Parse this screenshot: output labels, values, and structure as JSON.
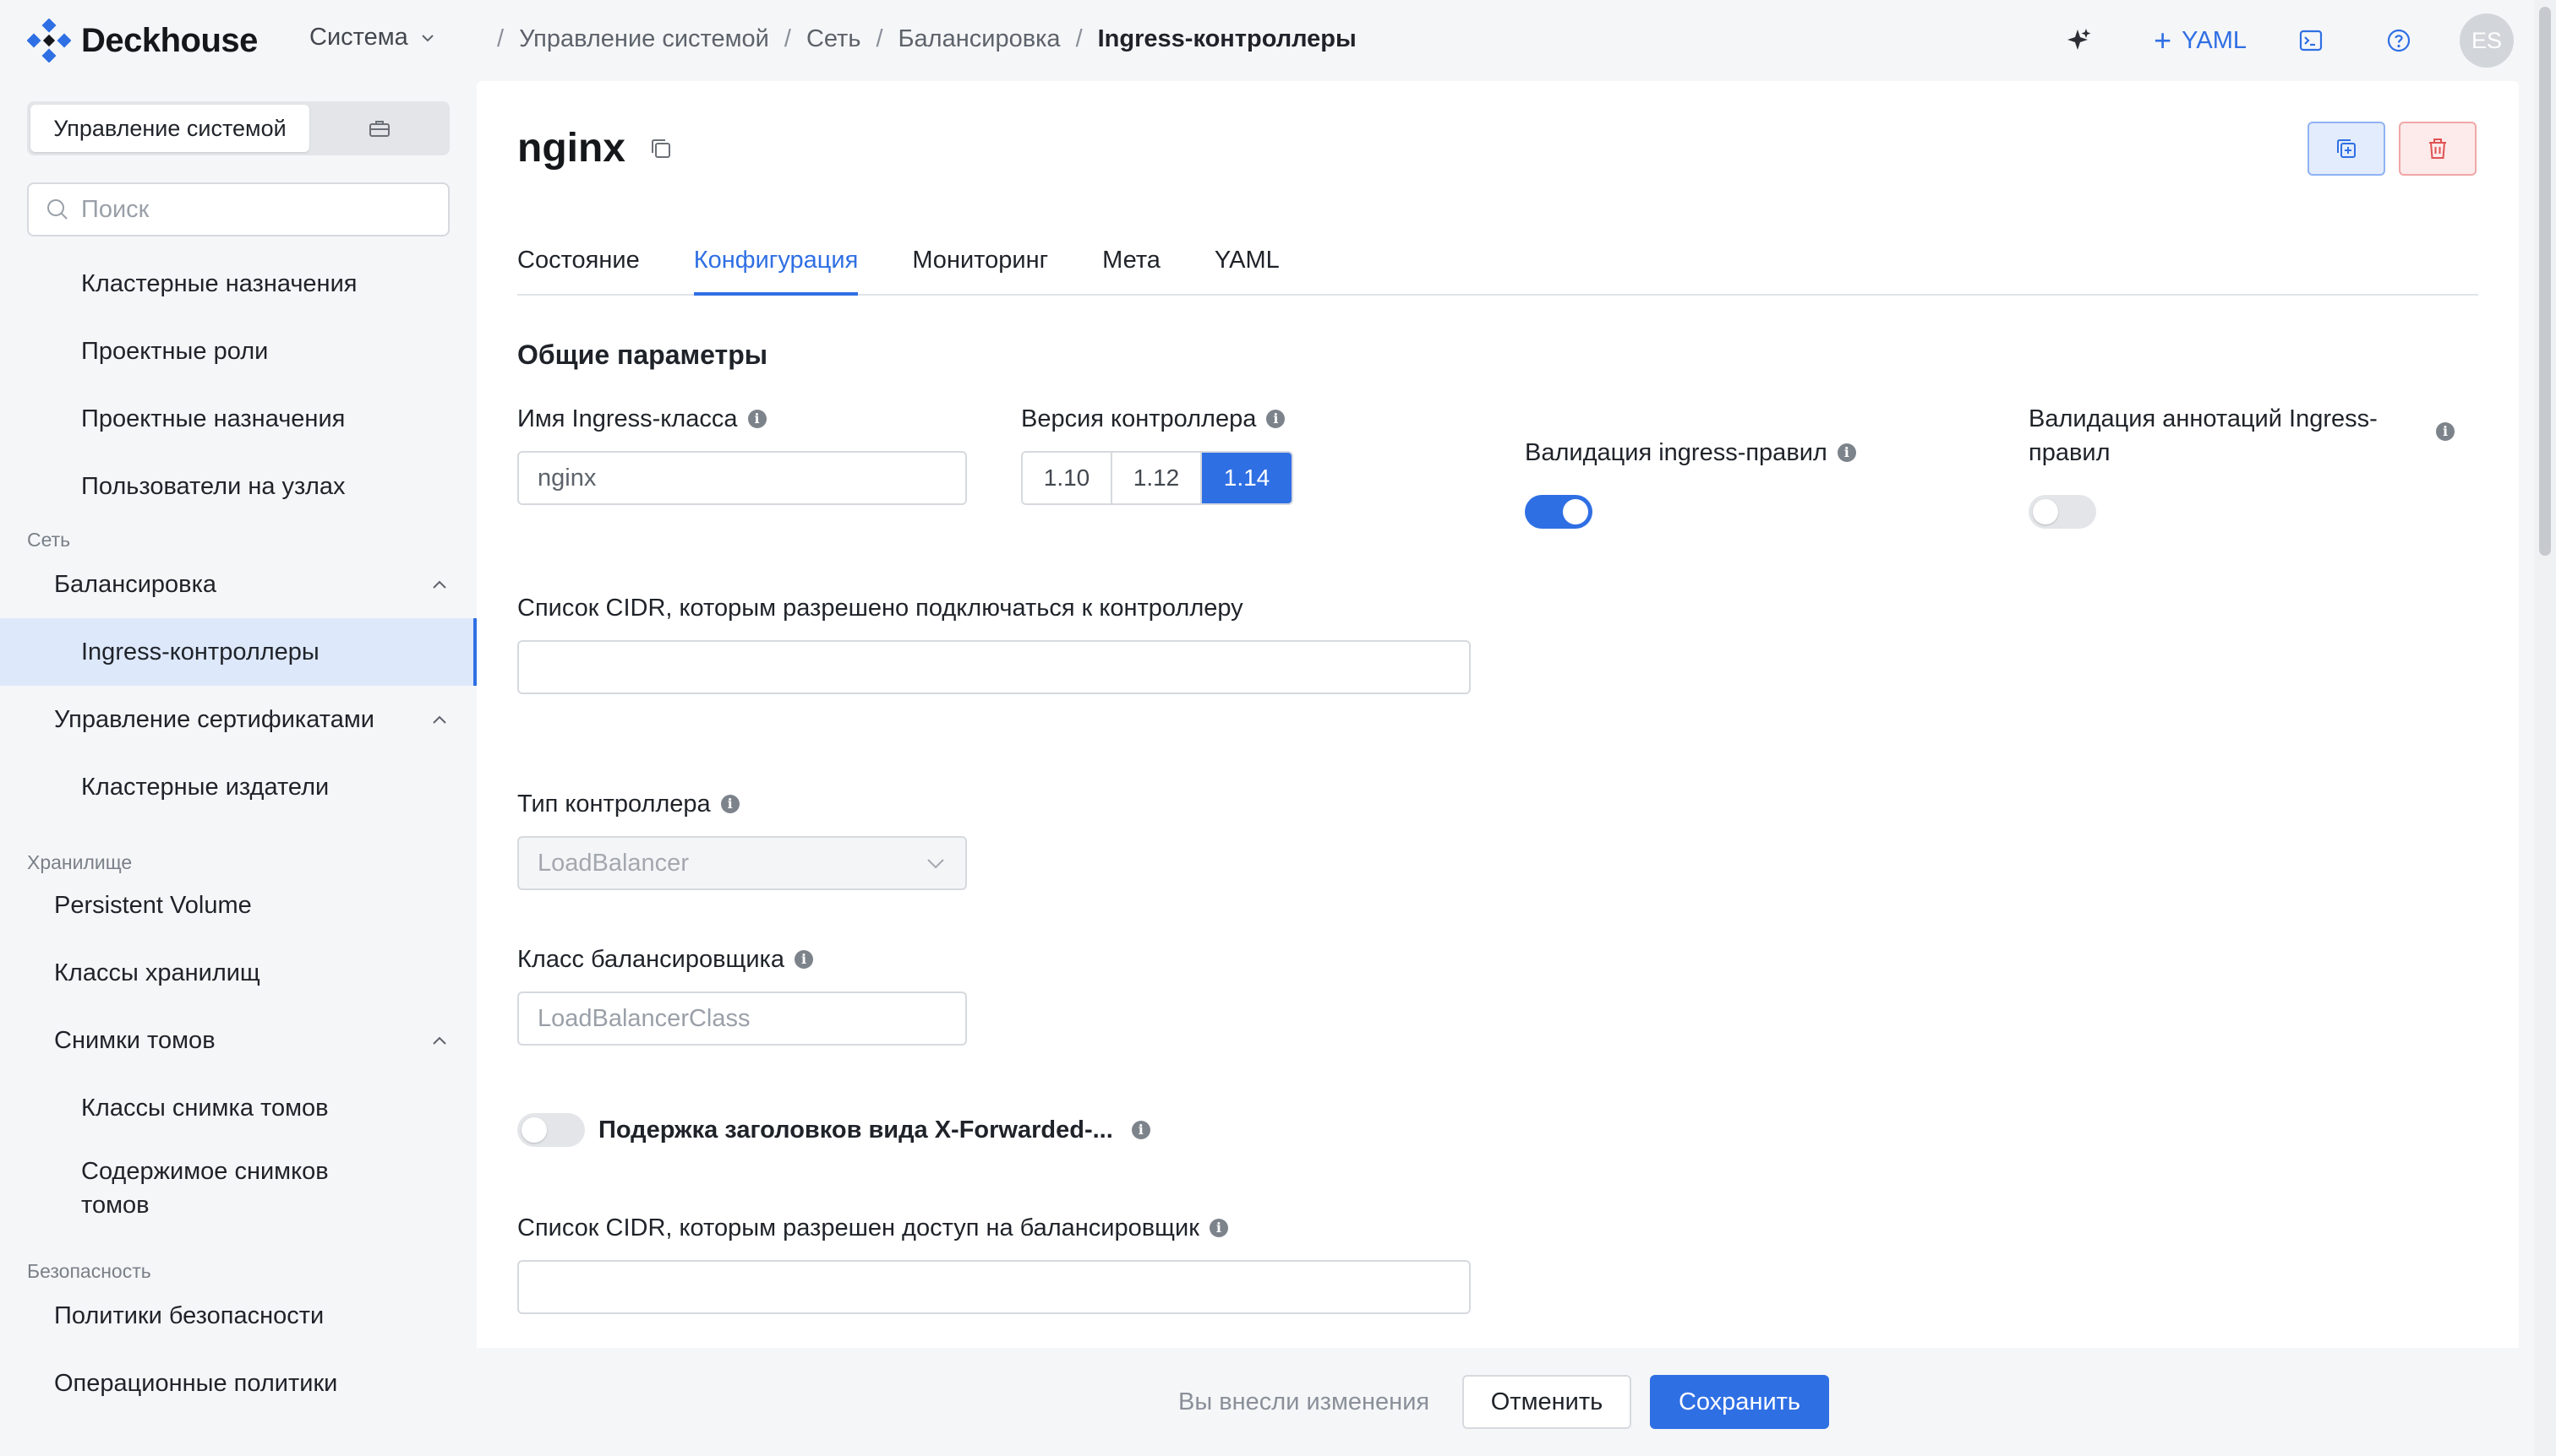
{
  "header": {
    "brand": "Deckhouse",
    "system_menu": "Система",
    "breadcrumbs": [
      "Управление системой",
      "Сеть",
      "Балансировка"
    ],
    "breadcrumb_current": "Ingress-контроллеры",
    "yaml_button": "YAML",
    "avatar_initials": "ES"
  },
  "sidebar": {
    "segment_active": "Управление системой",
    "search_placeholder": "Поиск",
    "items": [
      "Кластерные назначения",
      "Проектные роли",
      "Проектные назначения",
      "Пользователи на узлах",
      "Балансировка",
      "Ingress-контроллеры",
      "Управление сертификатами",
      "Кластерные издатели",
      "Persistent Volume",
      "Классы хранилищ",
      "Снимки томов",
      "Классы снимка томов",
      "Содержимое снимков томов",
      "Политики безопасности",
      "Операционные политики"
    ],
    "sections": [
      "Сеть",
      "Хранилище",
      "Безопасность"
    ]
  },
  "main": {
    "title": "nginx",
    "tabs": [
      "Состояние",
      "Конфигурация",
      "Мониторинг",
      "Мета",
      "YAML"
    ],
    "active_tab": "Конфигурация",
    "section_title": "Общие параметры",
    "fields": {
      "ingress_class_label": "Имя Ingress-класса",
      "ingress_class_value": "nginx",
      "controller_version_label": "Версия контроллера",
      "versions": [
        "1.10",
        "1.12",
        "1.14"
      ],
      "selected_version": "1.14",
      "ingress_validation_label": "Валидация ingress-правил",
      "ingress_validation_on": true,
      "annotation_validation_label": "Валидация аннотаций Ingress-правил",
      "annotation_validation_on": false,
      "cidr_controller_label": "Список CIDR, которым разрешено подключаться к контроллеру",
      "controller_type_label": "Тип контроллера",
      "controller_type_value": "LoadBalancer",
      "balancer_class_label": "Класс балансировщика",
      "balancer_class_placeholder": "LoadBalancerClass",
      "xforwarded_label": "Подержка заголовков вида X-Forwarded-...",
      "xforwarded_on": false,
      "cidr_balancer_label": "Список CIDR, которым разрешен доступ на балансировщик"
    }
  },
  "footer": {
    "changes_text": "Вы внесли изменения",
    "cancel": "Отменить",
    "save": "Сохранить"
  },
  "colors": {
    "accent": "#2f6fe4",
    "danger": "#e05252",
    "selected_bg": "#dde8fb"
  }
}
